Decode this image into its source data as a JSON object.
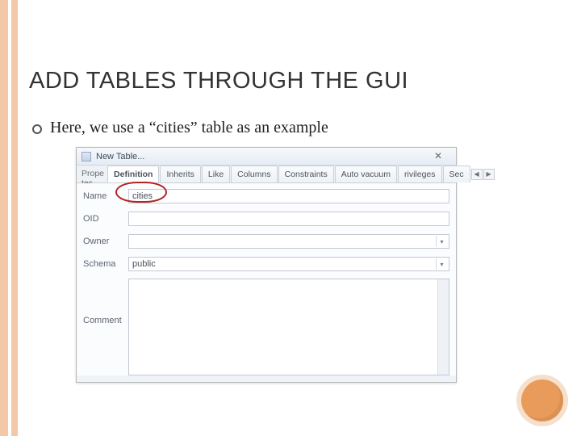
{
  "slide": {
    "title": "ADD TABLES THROUGH THE GUI",
    "bullet": "Here, we use a “cities” table as an example"
  },
  "dialog": {
    "title": "New Table...",
    "close_glyph": "✕",
    "leftLabel": "Prope tes",
    "tabs": {
      "definition": "Definition",
      "inherits": "Inherits",
      "like": "Like",
      "columns": "Columns",
      "constraints": "Constraints",
      "autovacuum": "Auto vacuum",
      "privileges": "rivileges",
      "security": "Sec"
    },
    "arrows": {
      "left": "◀",
      "right": "▶"
    },
    "fields": {
      "name_label": "Name",
      "name_value": "cities",
      "oid_label": "OID",
      "oid_value": "",
      "owner_label": "Owner",
      "owner_value": "",
      "schema_label": "Schema",
      "schema_value": "public",
      "comment_label": "Comment"
    },
    "dropdown_glyph": "▾"
  }
}
